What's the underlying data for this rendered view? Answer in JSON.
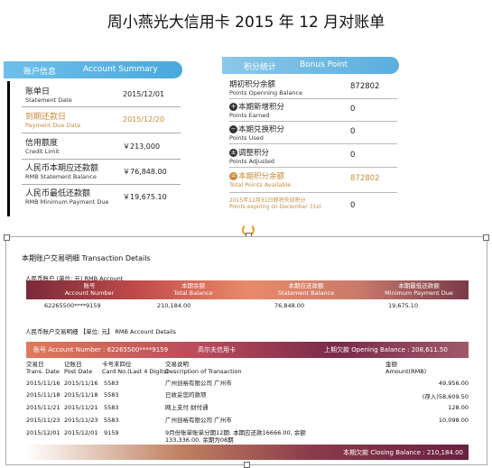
{
  "page_title": "周小燕光大信用卡 2015 年 12 月对账单",
  "account_summary": {
    "header_cn": "账户信息",
    "header_en": "Account Summary",
    "rows": [
      {
        "cn": "账单日",
        "en": "Statement Date",
        "value": "2015/12/01"
      },
      {
        "cn": "到期还款日",
        "en": "Payment Due Date",
        "value": "2015/12/20"
      },
      {
        "cn": "信用额度",
        "en": "Credit Limit",
        "value": "￥213,000"
      },
      {
        "cn": "人民币本期应还款额",
        "en": "RMB Statement Balance",
        "value": "￥76,848.00"
      },
      {
        "cn": "人民币最低还款额",
        "en": "RMB Minimum Payment Due",
        "value": "￥19,675.10"
      }
    ]
  },
  "points": {
    "header_cn": "积分统计",
    "header_en": "Bonus Point",
    "rows": [
      {
        "symbol": "",
        "cn": "期初积分余额",
        "en": "Points Openning Balance",
        "value": "872802"
      },
      {
        "symbol": "+",
        "cn": "本期新增积分",
        "en": "Points Earned",
        "value": "0"
      },
      {
        "symbol": "−",
        "cn": "本期兑换积分",
        "en": "Points Used",
        "value": "0"
      },
      {
        "symbol": "±",
        "cn": "调整积分",
        "en": "Points Adjusted",
        "value": "0"
      },
      {
        "symbol": "=",
        "cn": "本期积分余额",
        "en": "Total Points Available",
        "value": "872802"
      }
    ],
    "expiring_cn": "2015年12月31日即将失效积分",
    "expiring_en": "Points expiring on December 31st",
    "expiring_value": "0"
  },
  "transactions": {
    "title": "本期账户交易明细 Transaction Details",
    "summary_label": "人民币账户 (单位: 元) RMB Account",
    "summary_headers": [
      {
        "cn": "账号",
        "en": "Account Number"
      },
      {
        "cn": "本期余额",
        "en": "Total Balance"
      },
      {
        "cn": "本期应还款额",
        "en": "Statement Balance"
      },
      {
        "cn": "本期最低还款额",
        "en": "Minimum Payment Due"
      }
    ],
    "summary_values": [
      "62265500****9159",
      "210,184.00",
      "76,848.00",
      "19,675.10"
    ],
    "detail_label": "人民币账户交易明细 【单位: 元】 RMB Account Details",
    "detail_header_left": "账号 Account Number : 62265500****9159",
    "detail_header_card": "高尔夫信用卡",
    "detail_header_right": "上期欠款 Opening Balance : 208,611.50",
    "columns": [
      {
        "cn": "交易日",
        "en": "Trans. Date"
      },
      {
        "cn": "记账日",
        "en": "Post Date"
      },
      {
        "cn": "卡号末四位",
        "en": "Card No.(Last 4 Digits)"
      },
      {
        "cn": "交易说明",
        "en": "Description of Transaction"
      },
      {
        "cn": "金额",
        "en": "Amount(RMB)"
      }
    ],
    "rows": [
      {
        "trans_date": "2015/11/16",
        "post_date": "2015/11/16",
        "card": "5583",
        "desc": "广州创裕有限公司 广州市",
        "amount": "49,956.00"
      },
      {
        "trans_date": "2015/11/18",
        "post_date": "2015/11/18",
        "card": "5583",
        "desc": "已收妥您的款项",
        "amount": "(存入)58,609.50"
      },
      {
        "trans_date": "2015/11/21",
        "post_date": "2015/11/21",
        "card": "5583",
        "desc": "网上支付 财付通",
        "amount": "128.00"
      },
      {
        "trans_date": "2015/11/23",
        "post_date": "2015/11/23",
        "card": "5583",
        "desc": "广州创裕有限公司 广州市",
        "amount": "10,098.00"
      },
      {
        "trans_date": "2015/12/01",
        "post_date": "2015/12/01",
        "card": "9159",
        "desc": "9月份账单账单分期12期: 本期应还款16666.00, 余额133,336.00, 余期为08期",
        "amount": ""
      }
    ],
    "closing": "本期欠款 Closing Balance : 210,184.00"
  }
}
